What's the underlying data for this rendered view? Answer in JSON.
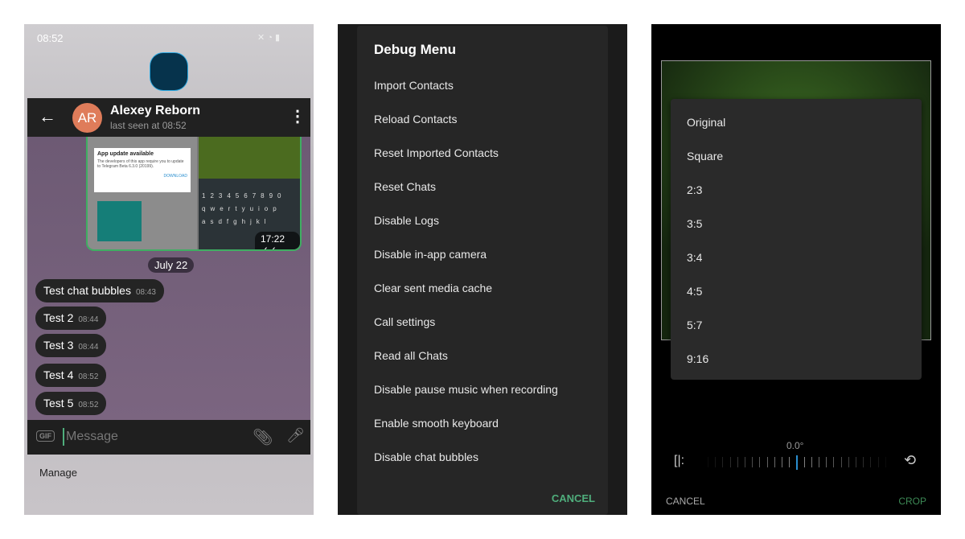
{
  "chat": {
    "status_time": "08:52",
    "contact_name": "Alexey Reborn",
    "avatar_initials": "AR",
    "avatar_color": "#df7c5a",
    "last_seen": "last seen at 08:52",
    "media": {
      "dialog_title": "App update available",
      "dialog_body": "The developers of this app require you to update to Telegram Beta 6.3.0 (20199).",
      "dialog_button": "DOWNLOAD",
      "time": "17:22"
    },
    "date_pill": "July 22",
    "messages": [
      {
        "text": "Test chat bubbles",
        "time": "08:43"
      },
      {
        "text": "Test 2",
        "time": "08:44"
      },
      {
        "text": "Test 3",
        "time": "08:44"
      },
      {
        "text": "Test 4",
        "time": "08:52"
      },
      {
        "text": "Test 5",
        "time": "08:52"
      }
    ],
    "gif_label": "GIF",
    "input_placeholder": "Message",
    "manage_label": "Manage"
  },
  "debug": {
    "title": "Debug Menu",
    "items": [
      "Import Contacts",
      "Reload Contacts",
      "Reset Imported Contacts",
      "Reset Chats",
      "Disable Logs",
      "Disable in-app camera",
      "Clear sent media cache",
      "Call settings",
      "Read all Chats",
      "Disable pause music when recording",
      "Enable smooth keyboard",
      "Disable chat bubbles"
    ],
    "cancel": "CANCEL",
    "accent": "#4fae7c"
  },
  "crop": {
    "ratios": [
      "Original",
      "Square",
      "2:3",
      "3:5",
      "3:4",
      "4:5",
      "5:7",
      "9:16"
    ],
    "angle": "0.0°",
    "cancel": "CANCEL",
    "crop": "CROP",
    "accent": "#3d8a56"
  }
}
